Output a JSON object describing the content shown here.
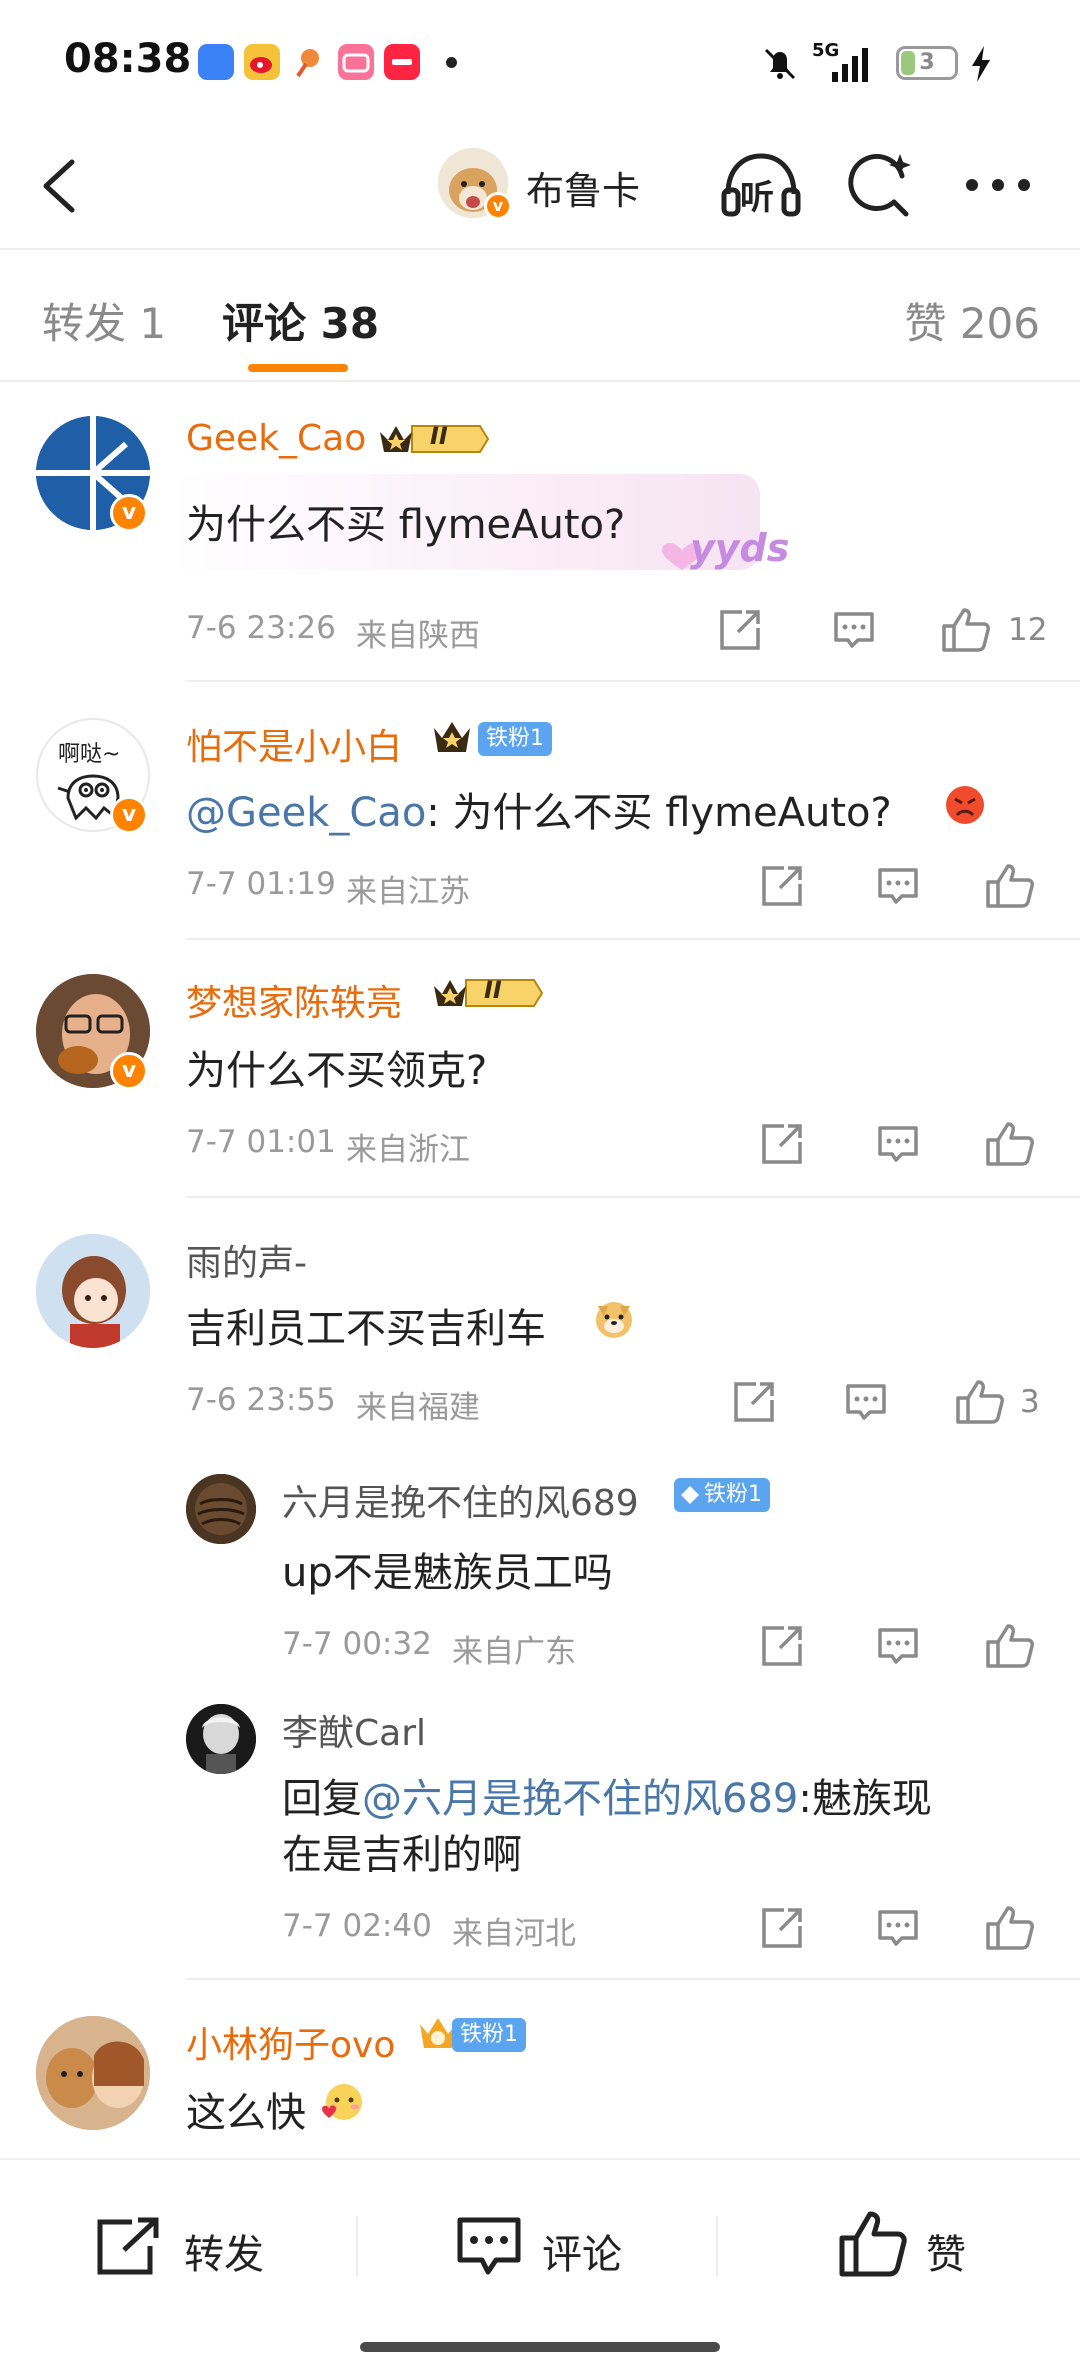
{
  "status_bar": {
    "time": "08:38",
    "battery": "3",
    "network": "5G",
    "icons": [
      "app-blue-icon",
      "weibo-icon",
      "app-orange-icon",
      "bilibili-icon",
      "xiaohongshu-icon",
      "mute-icon",
      "signal-icon",
      "charging-icon"
    ]
  },
  "header": {
    "title": "布鲁卡",
    "listen_label": "听",
    "icons": [
      "back-icon",
      "listen-icon",
      "search-icon",
      "more-icon"
    ]
  },
  "tabs": {
    "repost": "转发 1",
    "comment": "评论 38",
    "like": "赞 206"
  },
  "comments": [
    {
      "user": "Geek_Cao",
      "badge": "II",
      "text": "为什么不买 flymeAuto?",
      "sticker": "yyds",
      "time": "7-6 23:26",
      "location": "来自陕西",
      "likes": "12"
    },
    {
      "user": "怕不是小小白",
      "fan_badge": "铁粉1",
      "mention": "@Geek_Cao",
      "text": ": 为什么不买 flymeAuto?",
      "time": "7-7 01:19",
      "location": "来自江苏",
      "avatar_text": "啊哒~"
    },
    {
      "user": "梦想家陈轶亮",
      "badge": "II",
      "text": "为什么不买领克?",
      "time": "7-7 01:01",
      "location": "来自浙江"
    },
    {
      "user": "雨的声-",
      "text": "吉利员工不买吉利车",
      "time": "7-6 23:55",
      "location": "来自福建",
      "likes": "3",
      "replies": [
        {
          "user": "六月是挽不住的风689",
          "fan_badge": "铁粉1",
          "text": "up不是魅族员工吗",
          "time": "7-7 00:32",
          "location": "来自广东"
        },
        {
          "user": "李猷Carl",
          "prefix": "回复",
          "mention": "@六月是挽不住的风689",
          "text_line1": ":魅族现",
          "text_line2": "在是吉利的啊",
          "time": "7-7 02:40",
          "location": "来自河北"
        }
      ]
    },
    {
      "user": "小林狗子ovo",
      "fan_badge": "铁粉1",
      "text": "这么快"
    }
  ],
  "bottom_bar": {
    "repost": "转发",
    "comment": "评论",
    "like": "赞"
  },
  "colors": {
    "accent": "#ff8200",
    "username_orange": "#e86b0c",
    "mention_blue": "#4a77a8",
    "meta_gray": "#9a9a9a"
  }
}
